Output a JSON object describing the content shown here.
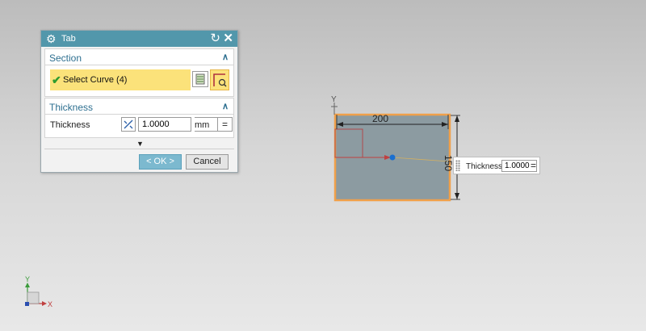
{
  "dialog": {
    "title": "Tab",
    "section": {
      "header": "Section",
      "select_label": "Select Curve (4)"
    },
    "thickness": {
      "header": "Thickness",
      "label": "Thickness",
      "value": "1.0000",
      "unit": "mm"
    },
    "ok_label": "< OK >",
    "cancel_label": "Cancel"
  },
  "viewport": {
    "width_dim": "200",
    "height_dim": "150",
    "popup_label": "Thickness",
    "popup_value": "1.0000",
    "axis_y": "Y",
    "triad_y": "Y",
    "triad_x": "X"
  },
  "colors": {
    "title_bar": "#5297ab",
    "selection_highlight": "#fbe27a",
    "sheet_fill": "#8c9ba1",
    "sheet_outline": "#f0a04a"
  }
}
